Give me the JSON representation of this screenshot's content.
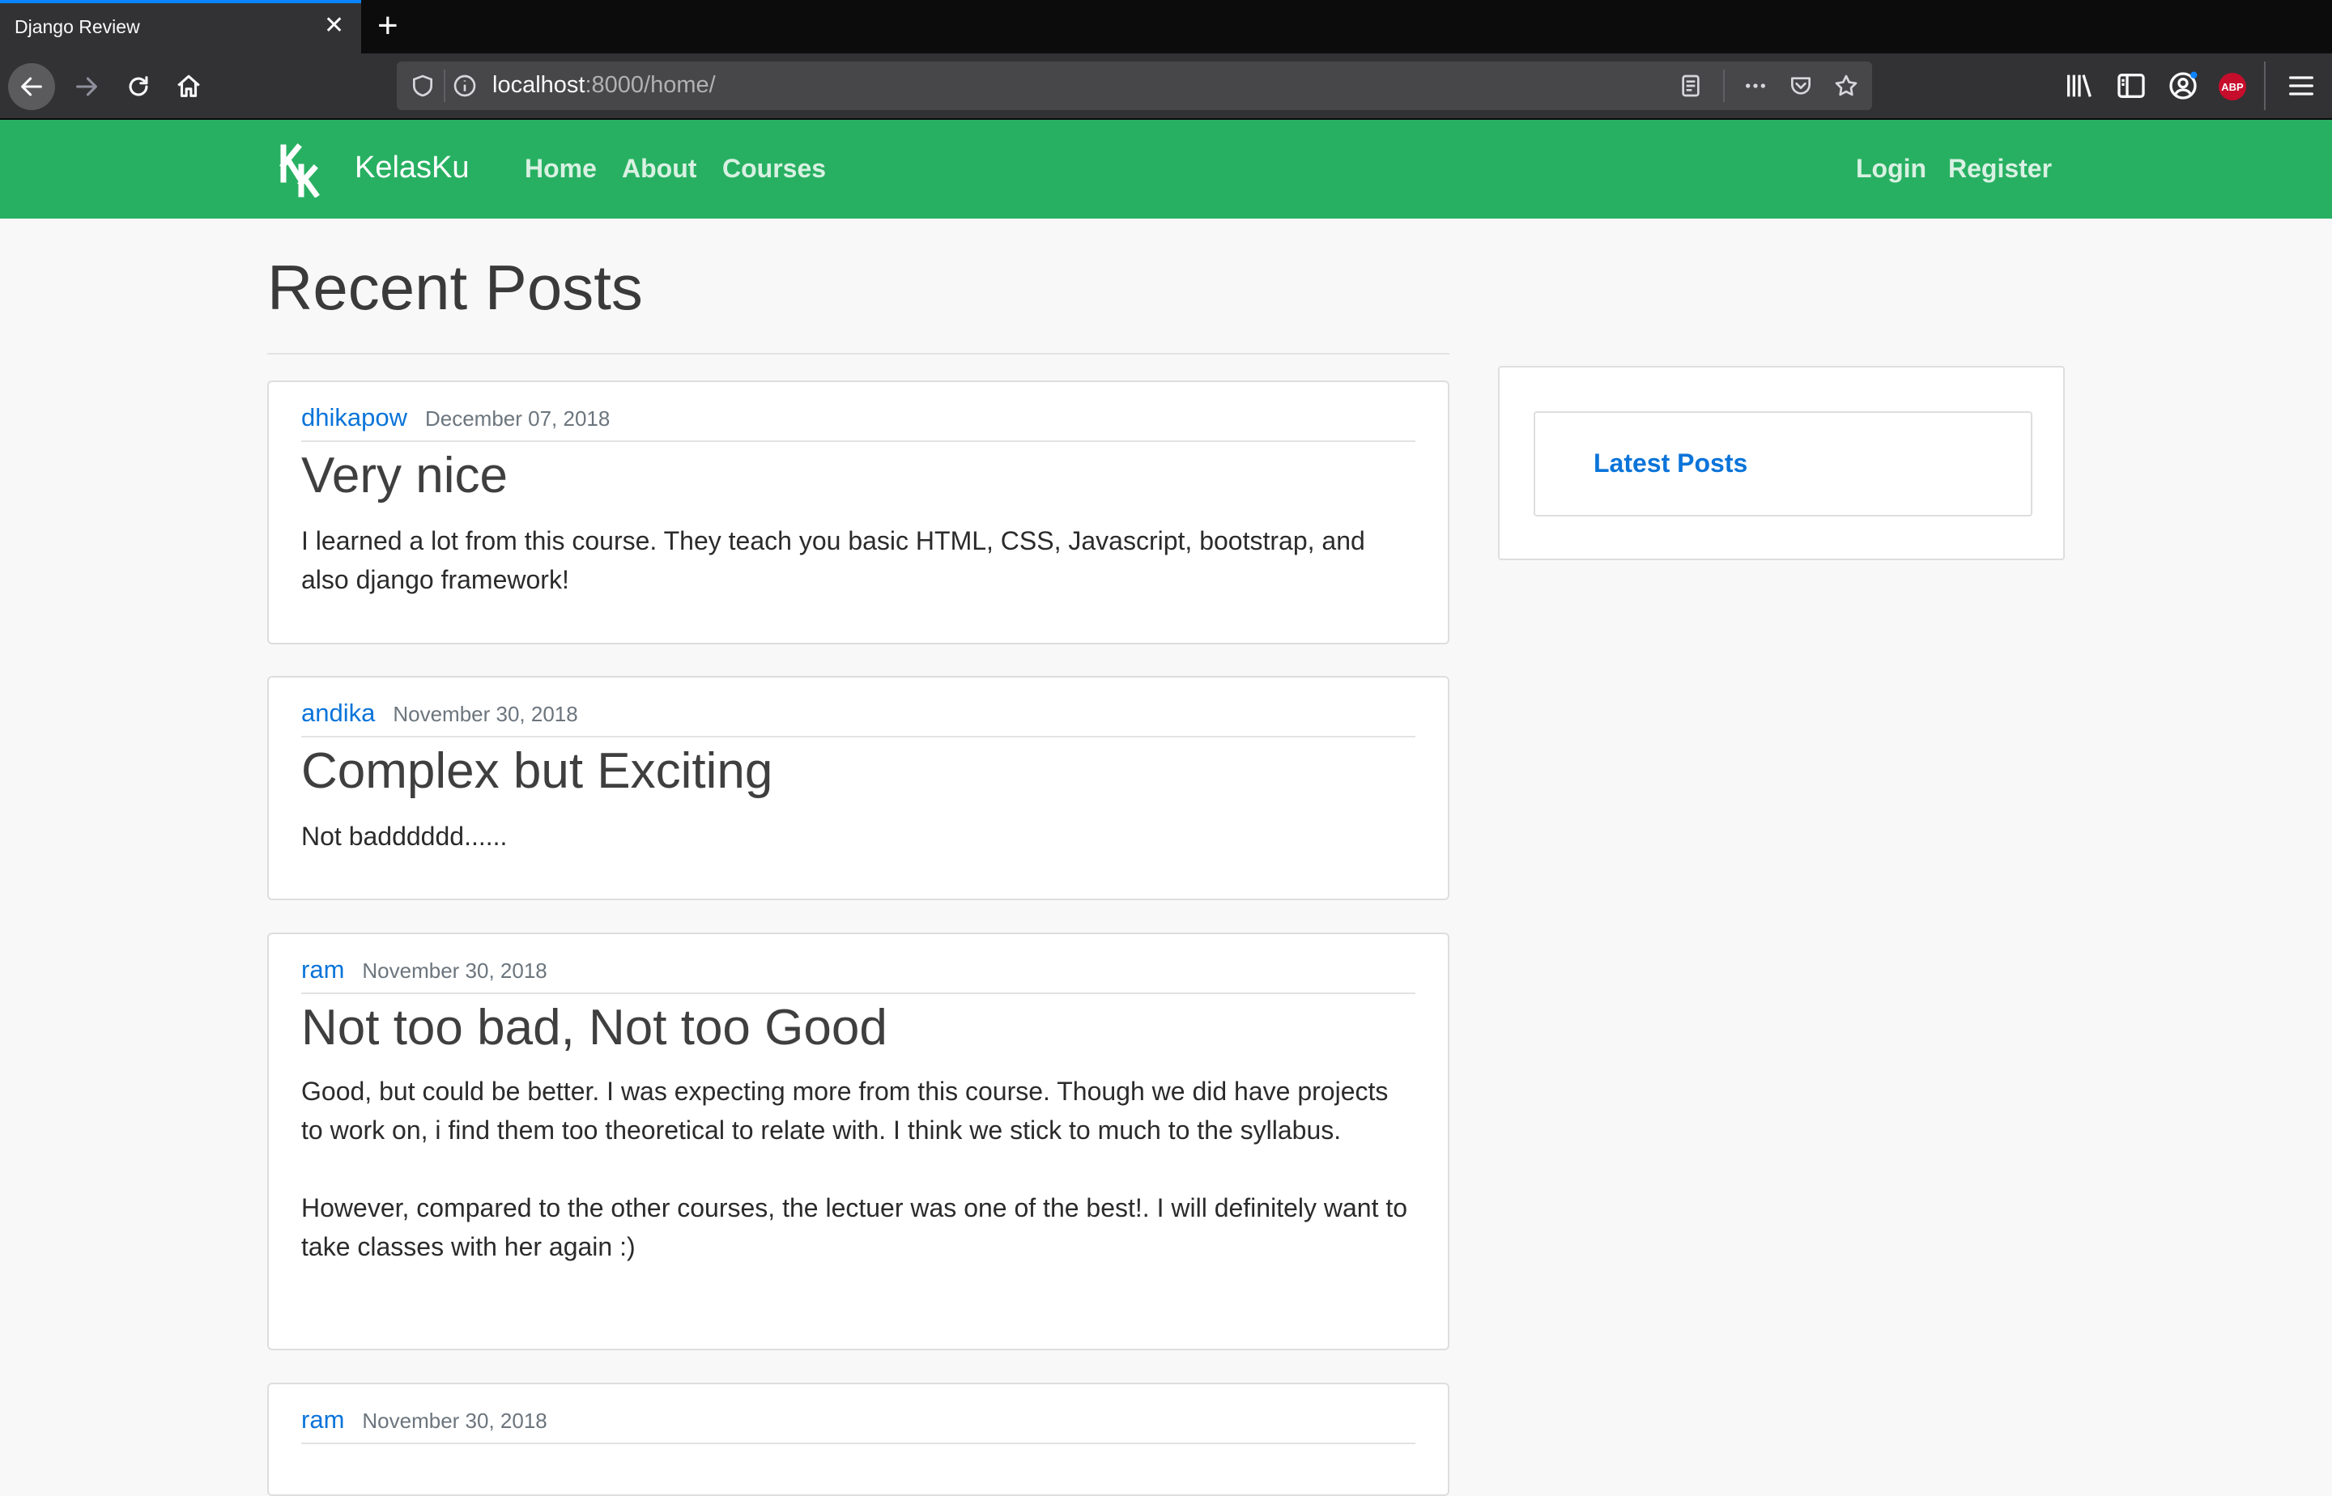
{
  "browser": {
    "tab_title": "Django Review",
    "url_host": "localhost",
    "url_rest": ":8000/home/",
    "abp_label": "ABP"
  },
  "site": {
    "brand": "KelasKu",
    "nav": {
      "home": "Home",
      "about": "About",
      "courses": "Courses",
      "login": "Login",
      "register": "Register"
    }
  },
  "main": {
    "heading": "Recent Posts",
    "posts": [
      {
        "author": "dhikapow",
        "date": "December 07, 2018",
        "title": "Very nice",
        "body": [
          "I learned a lot from this course. They teach you basic HTML, CSS, Javascript, bootstrap, and also django framework!"
        ]
      },
      {
        "author": "andika",
        "date": "November 30, 2018",
        "title": "Complex but Exciting",
        "body": [
          "Not badddddd......"
        ]
      },
      {
        "author": "ram",
        "date": "November 30, 2018",
        "title": "Not too bad, Not too Good",
        "body": [
          "Good, but could be better. I was expecting more from this course. Though we did have projects to work on, i find them too theoretical to relate with. I think we stick to much to the syllabus.",
          "However, compared to the other courses, the lectuer was one of the best!. I will definitely want to take classes with her again :)"
        ]
      },
      {
        "author": "ram",
        "date": "November 30, 2018"
      }
    ]
  },
  "sidebar": {
    "title": "Latest Posts"
  },
  "colors": {
    "navbar": "#28b062",
    "link": "#0a74d9",
    "page_bg": "#f8f8f8"
  }
}
